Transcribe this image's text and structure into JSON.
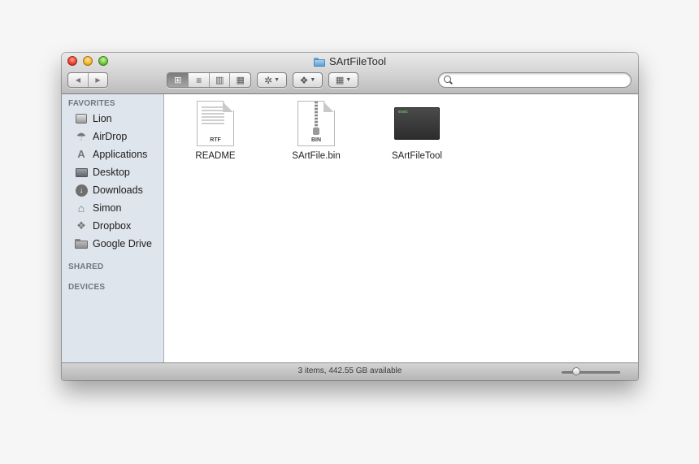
{
  "window": {
    "title": "SArtFileTool",
    "title_icon": "folder-icon"
  },
  "toolbar": {
    "nav": {
      "back": "◀",
      "forward": "▶"
    },
    "view_modes": [
      {
        "name": "icon-view",
        "glyph": "⊞",
        "active": true
      },
      {
        "name": "list-view",
        "glyph": "≡",
        "active": false
      },
      {
        "name": "column-view",
        "glyph": "▥",
        "active": false
      },
      {
        "name": "coverflow-view",
        "glyph": "▦",
        "active": false
      }
    ],
    "action_glyph": "✲",
    "dropbox_glyph": "❖",
    "arrange_glyph": "▦",
    "search_placeholder": ""
  },
  "sidebar": {
    "sections": {
      "favorites": "FAVORITES",
      "shared": "SHARED",
      "devices": "DEVICES"
    },
    "items": [
      {
        "label": "Lion",
        "icon": "hard-disk-icon"
      },
      {
        "label": "AirDrop",
        "icon": "airdrop-icon"
      },
      {
        "label": "Applications",
        "icon": "applications-icon"
      },
      {
        "label": "Desktop",
        "icon": "desktop-icon"
      },
      {
        "label": "Downloads",
        "icon": "downloads-icon"
      },
      {
        "label": "Simon",
        "icon": "home-icon"
      },
      {
        "label": "Dropbox",
        "icon": "dropbox-icon"
      },
      {
        "label": "Google Drive",
        "icon": "folder-icon"
      }
    ]
  },
  "files": [
    {
      "name": "README",
      "type_tag": "RTF",
      "icon": "rtf-document-icon"
    },
    {
      "name": "SArtFile.bin",
      "type_tag": "BIN",
      "icon": "archive-bin-icon"
    },
    {
      "name": "SArtFileTool",
      "type_tag": "exec",
      "icon": "unix-executable-icon"
    }
  ],
  "status": {
    "text": "3 items, 442.55 GB available",
    "icon_size_fraction": 0.25
  },
  "colors": {
    "sidebar_bg": "#dfe5ec",
    "section_header": "#6d7883",
    "close": "#e5402f",
    "minimize": "#f1b42a",
    "maximize": "#6cc53b"
  }
}
